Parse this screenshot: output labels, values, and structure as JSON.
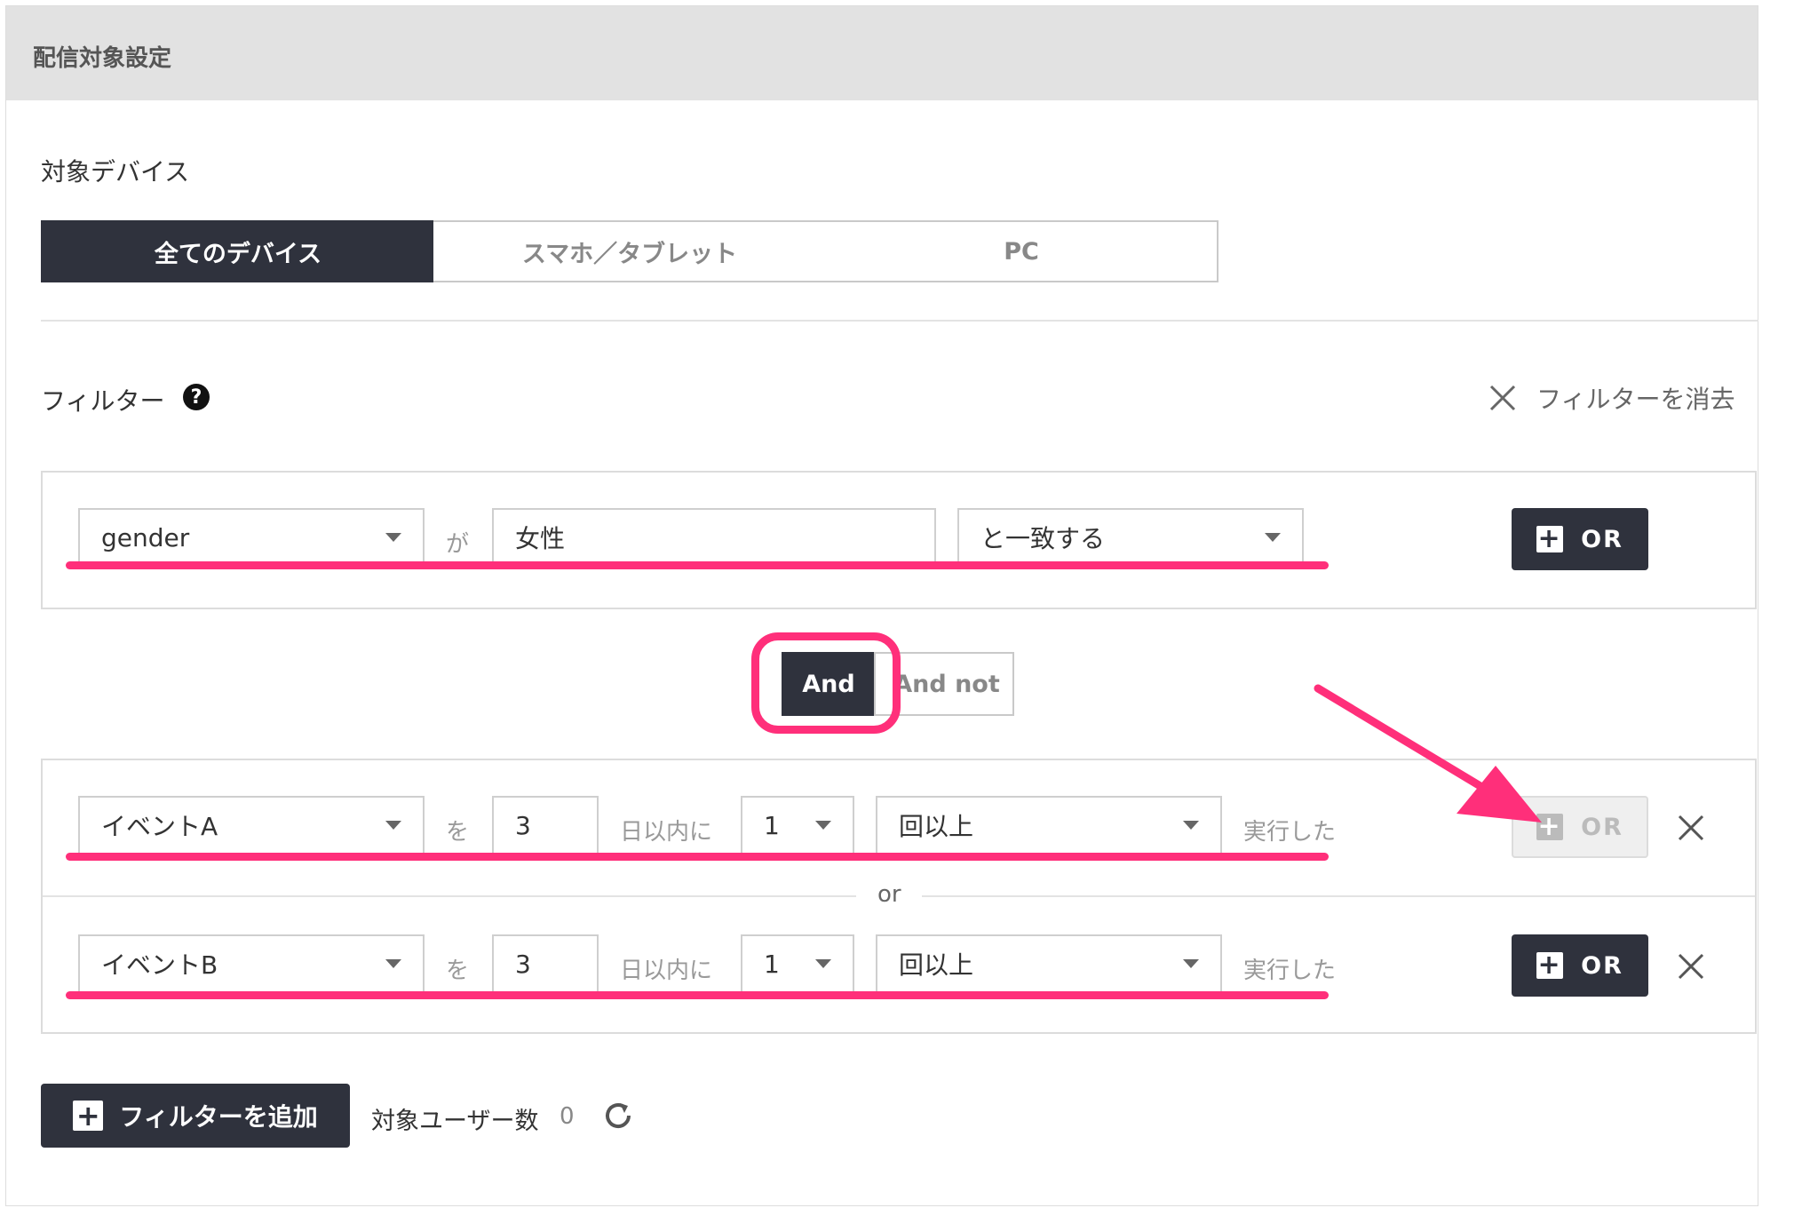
{
  "panel": {
    "title": "配信対象設定"
  },
  "device": {
    "label": "対象デバイス",
    "options": [
      "全てのデバイス",
      "スマホ／タブレット",
      "PC"
    ],
    "selected": "全てのデバイス"
  },
  "filter": {
    "label": "フィルター",
    "help_icon": "?",
    "clear_label": "フィルターを消去"
  },
  "group1": {
    "attribute": "gender",
    "connector": "が",
    "value": "女性",
    "operator": "と一致する",
    "or_label": "OR"
  },
  "logic": {
    "and_label": "And",
    "and_not_label": "And not",
    "selected": "And"
  },
  "group2": {
    "rows": [
      {
        "event": "イベントA",
        "connector": "を",
        "days": "3",
        "days_suffix": "日以内に",
        "times": "1",
        "times_op": "回以上",
        "suffix": "実行した",
        "or_label": "OR",
        "or_disabled": true
      },
      {
        "event": "イベントB",
        "connector": "を",
        "days": "3",
        "days_suffix": "日以内に",
        "times": "1",
        "times_op": "回以上",
        "suffix": "実行した",
        "or_label": "OR",
        "or_disabled": false
      }
    ],
    "or_separator": "or"
  },
  "footer": {
    "add_filter_label": "フィルターを追加",
    "target_users_label": "対象ユーザー数",
    "target_users_count": "0"
  },
  "colors": {
    "dark": "#2f323d",
    "highlight": "#ff2f7a",
    "header_bg": "#e2e2e2"
  }
}
